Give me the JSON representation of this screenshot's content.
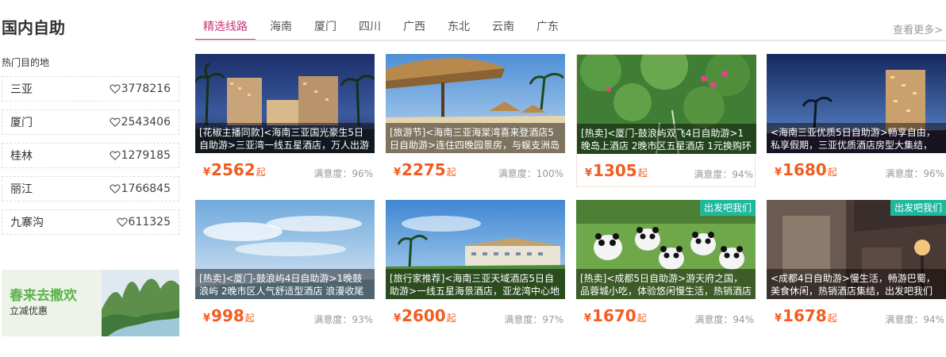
{
  "section": {
    "title": "国内自助"
  },
  "tabs": [
    {
      "label": "精选线路",
      "active": true
    },
    {
      "label": "海南"
    },
    {
      "label": "厦门"
    },
    {
      "label": "四川"
    },
    {
      "label": "广西"
    },
    {
      "label": "东北"
    },
    {
      "label": "云南"
    },
    {
      "label": "广东"
    }
  ],
  "more": "查看更多>",
  "sidebar": {
    "heading": "热门目的地",
    "destinations": [
      {
        "name": "三亚",
        "count": "3778216"
      },
      {
        "name": "厦门",
        "count": "2543406"
      },
      {
        "name": "桂林",
        "count": "1279185"
      },
      {
        "name": "丽江",
        "count": "1766845"
      },
      {
        "name": "九寨沟",
        "count": "611325"
      }
    ],
    "promo": {
      "title": "春来去撒欢",
      "subtitle": "立减优惠"
    }
  },
  "products": [
    {
      "caption": "[花椒主播同款]<海南三亚国光豪生5日自助游>三亚湾一线五星酒店，万人出游",
      "yen": "¥",
      "price": "2562",
      "unit": "起",
      "satisfaction": "满意度：96%",
      "badge": ""
    },
    {
      "caption": "[旅游节]<海南三亚海棠湾喜来登酒店5日自助游>连住四晚园景房，与蜈支洲岛",
      "yen": "¥",
      "price": "2275",
      "unit": "起",
      "satisfaction": "满意度：100%",
      "badge": ""
    },
    {
      "caption": "[热卖]<厦门-鼓浪屿双飞4日自助游>1晚岛上酒店 2晚市区五星酒店 1元换购环岛",
      "yen": "¥",
      "price": "1305",
      "unit": "起",
      "satisfaction": "满意度：94%",
      "badge": ""
    },
    {
      "caption": "<海南三亚优质5日自助游>畅享自由，私享假期，三亚优质酒店房型大集结，",
      "yen": "¥",
      "price": "1680",
      "unit": "起",
      "satisfaction": "满意度：96%",
      "badge": ""
    },
    {
      "caption": "[热卖]<厦门-鼓浪屿4日自助游>1晚鼓浪屿 2晚市区人气舒适型酒店 浪漫收尾 万",
      "yen": "¥",
      "price": "998",
      "unit": "起",
      "satisfaction": "满意度：93%",
      "badge": ""
    },
    {
      "caption": "[旅行家推荐]<海南三亚天域酒店5日自助游>一线五星海景酒店，亚龙湾中心地",
      "yen": "¥",
      "price": "2600",
      "unit": "起",
      "satisfaction": "满意度：97%",
      "badge": ""
    },
    {
      "caption": "[热卖]<成都5日自助游>游天府之国，品蓉城小吃，体验悠闲慢生活，热销酒店",
      "yen": "¥",
      "price": "1670",
      "unit": "起",
      "satisfaction": "满意度：94%",
      "badge": "出发吧我们"
    },
    {
      "caption": "<成都4日自助游>慢生活，畅游巴蜀，美食休闲，热销酒店集结，出发吧我们",
      "yen": "¥",
      "price": "1678",
      "unit": "起",
      "satisfaction": "满意度：94%",
      "badge": "出发吧我们"
    }
  ]
}
